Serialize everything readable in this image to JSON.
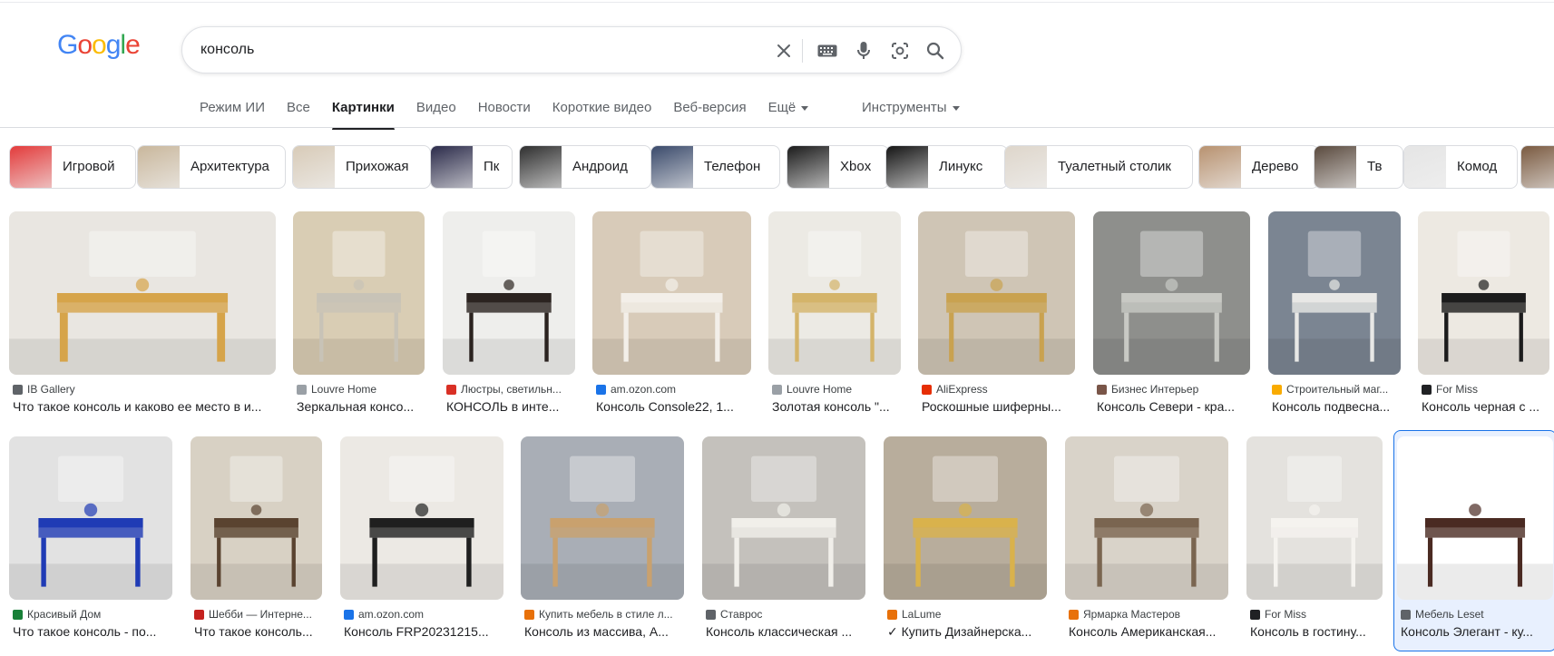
{
  "logo": {
    "letters": [
      "G",
      "o",
      "o",
      "g",
      "l",
      "e"
    ],
    "colors": [
      "#4285F4",
      "#EA4335",
      "#FBBC05",
      "#4285F4",
      "#34A853",
      "#EA4335"
    ]
  },
  "search": {
    "value": "консоль",
    "icons": [
      "close-icon",
      "keyboard-icon",
      "mic-icon",
      "lens-icon",
      "search-icon"
    ]
  },
  "tabs": [
    {
      "label": "Режим ИИ"
    },
    {
      "label": "Все"
    },
    {
      "label": "Картинки",
      "active": true
    },
    {
      "label": "Видео"
    },
    {
      "label": "Новости"
    },
    {
      "label": "Короткие видео"
    },
    {
      "label": "Веб-версия"
    },
    {
      "label": "Ещё"
    }
  ],
  "tools_label": "Инструменты",
  "chips": [
    {
      "label": "Игровой",
      "color": "#e33b3b"
    },
    {
      "label": "Архитектура",
      "color": "#c9b79c"
    },
    {
      "label": "Прихожая",
      "color": "#d8cbb8"
    },
    {
      "label": "Пк",
      "color": "#2b2b4a"
    },
    {
      "label": "Андроид",
      "color": "#2f2f2f"
    },
    {
      "label": "Телефон",
      "color": "#3a4a6b"
    },
    {
      "label": "Xbox",
      "color": "#1b1b1b"
    },
    {
      "label": "Линукс",
      "color": "#151515"
    },
    {
      "label": "Туалетный столик",
      "color": "#ded6cb"
    },
    {
      "label": "Дерево",
      "color": "#b89270"
    },
    {
      "label": "Тв",
      "color": "#5a4a3e"
    },
    {
      "label": "Комод",
      "color": "#e5e5e5"
    },
    {
      "label": "",
      "color": "#7a5a40"
    }
  ],
  "row1": [
    {
      "source": "IB Gallery",
      "title": "Что такое консоль и каково ее место в и...",
      "bg": "#e9e6e1",
      "furn": "#d6a44a",
      "icon_color": "#5f6368"
    },
    {
      "source": "Louvre Home",
      "title": "Зеркальная консо...",
      "bg": "#d9cdb4",
      "furn": "#c8c3b7",
      "icon_color": "#9aa0a6"
    },
    {
      "source": "Люстры, светильн...",
      "title": "КОНСОЛЬ в инте...",
      "bg": "#eeeeec",
      "furn": "#2b2320",
      "icon_color": "#d93025"
    },
    {
      "source": "am.ozon.com",
      "title": "Консоль Console22, 1...",
      "bg": "#d8cbb9",
      "furn": "#f3efe9",
      "icon_color": "#1a73e8"
    },
    {
      "source": "Louvre Home",
      "title": "Золотая консоль \"...",
      "bg": "#eceae4",
      "furn": "#d4b46a",
      "icon_color": "#9aa0a6"
    },
    {
      "source": "AliExpress",
      "title": "Роскошные шиферны...",
      "bg": "#cfc5b5",
      "furn": "#c9a250",
      "icon_color": "#e62e04"
    },
    {
      "source": "Бизнес Интерьер",
      "title": "Консоль Севери - кра...",
      "bg": "#8e8f8c",
      "furn": "#c8c9c4",
      "icon_color": "#795548"
    },
    {
      "source": "Строительный маг...",
      "title": "Консоль подвесна...",
      "bg": "#7b8592",
      "furn": "#e8e8e6",
      "icon_color": "#f9ab00"
    },
    {
      "source": "For Miss",
      "title": "Консоль черная с ...",
      "bg": "#ede9e2",
      "furn": "#1c1c1c",
      "icon_color": "#202124"
    }
  ],
  "row2": [
    {
      "source": "Красивый Дом",
      "title": "Что такое консоль - по...",
      "bg": "#e2e2e2",
      "furn": "#1f3bb5",
      "icon_color": "#188038"
    },
    {
      "source": "Шебби — Интерне...",
      "title": "Что такое консоль...",
      "bg": "#d8d1c4",
      "furn": "#5a4330",
      "icon_color": "#c5221f"
    },
    {
      "source": "am.ozon.com",
      "title": "Консоль FRP20231215...",
      "bg": "#ece9e4",
      "furn": "#1f1f1f",
      "icon_color": "#1a73e8"
    },
    {
      "source": "Купить мебель в стиле л...",
      "title": "Консоль из массива, А...",
      "bg": "#a9aeb6",
      "furn": "#c9a16e",
      "icon_color": "#e8710a"
    },
    {
      "source": "Ставрос",
      "title": "Консоль классическая ...",
      "bg": "#c4c1bc",
      "furn": "#f1efea",
      "icon_color": "#5f6368"
    },
    {
      "source": "LaLume",
      "title": "✓ Купить Дизайнерска...",
      "bg": "#b8ad9c",
      "furn": "#d9b24c",
      "icon_color": "#e8710a"
    },
    {
      "source": "Ярмарка Мастеров",
      "title": "Консоль Американская...",
      "bg": "#d9d3c9",
      "furn": "#7a6550",
      "icon_color": "#e8710a"
    },
    {
      "source": "For Miss",
      "title": "Консоль в гостину...",
      "bg": "#e4e2de",
      "furn": "#f5f3ef",
      "icon_color": "#202124"
    },
    {
      "source": "Мебель Leset",
      "title": "Консоль Элегант - ку...",
      "bg": "#ffffff",
      "furn": "#4a2a22",
      "icon_color": "#5f6368"
    }
  ]
}
